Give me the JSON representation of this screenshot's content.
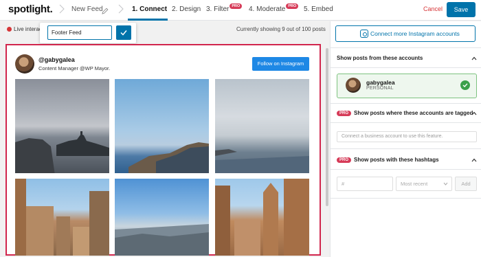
{
  "header": {
    "logo": "spotlight.",
    "feed_name": "New Feed",
    "steps": [
      {
        "label": "1. Connect",
        "active": true,
        "pro": false
      },
      {
        "label": "2. Design",
        "active": false,
        "pro": false
      },
      {
        "label": "3. Filter",
        "active": false,
        "pro": true
      },
      {
        "label": "4. Moderate",
        "active": false,
        "pro": true
      },
      {
        "label": "5. Embed",
        "active": false,
        "pro": false
      }
    ],
    "pro_badge": "PRO",
    "cancel_label": "Cancel",
    "save_label": "Save"
  },
  "toolbar": {
    "live_label": "Live interac",
    "feed_name_value": "Footer Feed",
    "showing_text": "Currently showing 9 out of 100 posts"
  },
  "preview": {
    "username": "@gabygalea",
    "bio": "Content Manager @WP Mayor.",
    "follow_label": "Follow on Instagram"
  },
  "sidebar": {
    "connect_label": "Connect more Instagram accounts",
    "section_accounts": "Show posts from these accounts",
    "account": {
      "name": "gabygalea",
      "type": "PERSONAL"
    },
    "pro_badge": "PRO",
    "section_tagged": "Show posts where these accounts are tagged",
    "business_placeholder": "Connect a business account to use this feature.",
    "section_hashtags": "Show posts with these hashtags",
    "hashtag_placeholder": "#",
    "sort_value": "Most recent",
    "add_label": "Add"
  },
  "colors": {
    "accent": "#0073aa",
    "pro": "#d63b58",
    "highlight_border": "#d1254c",
    "success": "#3ba04a"
  }
}
